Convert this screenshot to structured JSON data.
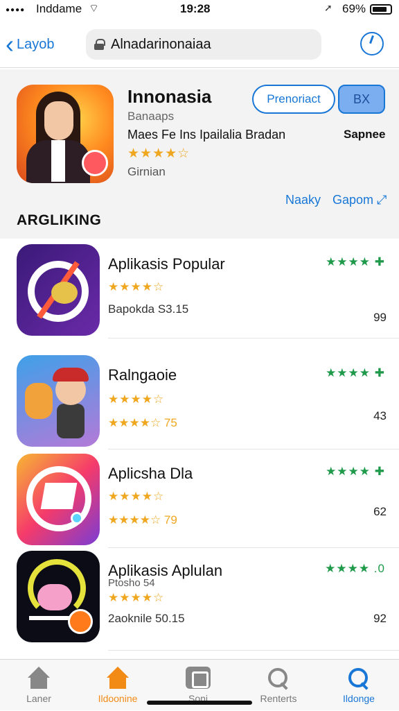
{
  "status": {
    "carrier": "Inddame",
    "time": "19:28",
    "battery": "69%"
  },
  "nav": {
    "back_label": "Layob",
    "url": "Alnadarinonaiaa"
  },
  "featured": {
    "title": "Innonasia",
    "subtitle": "Banaaps",
    "description": "Maes Fe Ins Ipailalia Bradan",
    "rating_stars": "★★★★☆",
    "category": "Girnian",
    "primary_button": "Prenoriact",
    "secondary_button": "BX",
    "right_label": "Sapnee",
    "link_left": "Naaky",
    "link_right": "Gapom ⤢"
  },
  "section_title": "ARGLIKING",
  "apps": [
    {
      "name": "Aplikasis Popular",
      "stars": "★★★★☆",
      "meta": "Bapokda S3.15",
      "green": "★★★★ ✚",
      "count": "99"
    },
    {
      "name": "Ralngaoie",
      "stars": "★★★★☆",
      "meta": "★★★★☆ 75",
      "green": "★★★★ ✚",
      "count": "43"
    },
    {
      "name": "Aplicsha Dla",
      "stars": "★★★★☆",
      "meta": "★★★★☆ 79",
      "green": "★★★★ ✚",
      "count": "62"
    },
    {
      "name": "Aplikasis Aplulan",
      "sub": "Ptosho 54",
      "stars": "★★★★☆",
      "meta": "2aoknile 50.15",
      "green": "★★★★ .0",
      "count": "92"
    }
  ],
  "tabs": [
    {
      "label": "Laner"
    },
    {
      "label": "Ildoonine"
    },
    {
      "label": "Soni"
    },
    {
      "label": "Renterts"
    },
    {
      "label": "Ildonge"
    }
  ],
  "colors": {
    "accent": "#1877d6",
    "star": "#f0a720",
    "green": "#1f9a4a",
    "active_tab": "#f28a16"
  }
}
